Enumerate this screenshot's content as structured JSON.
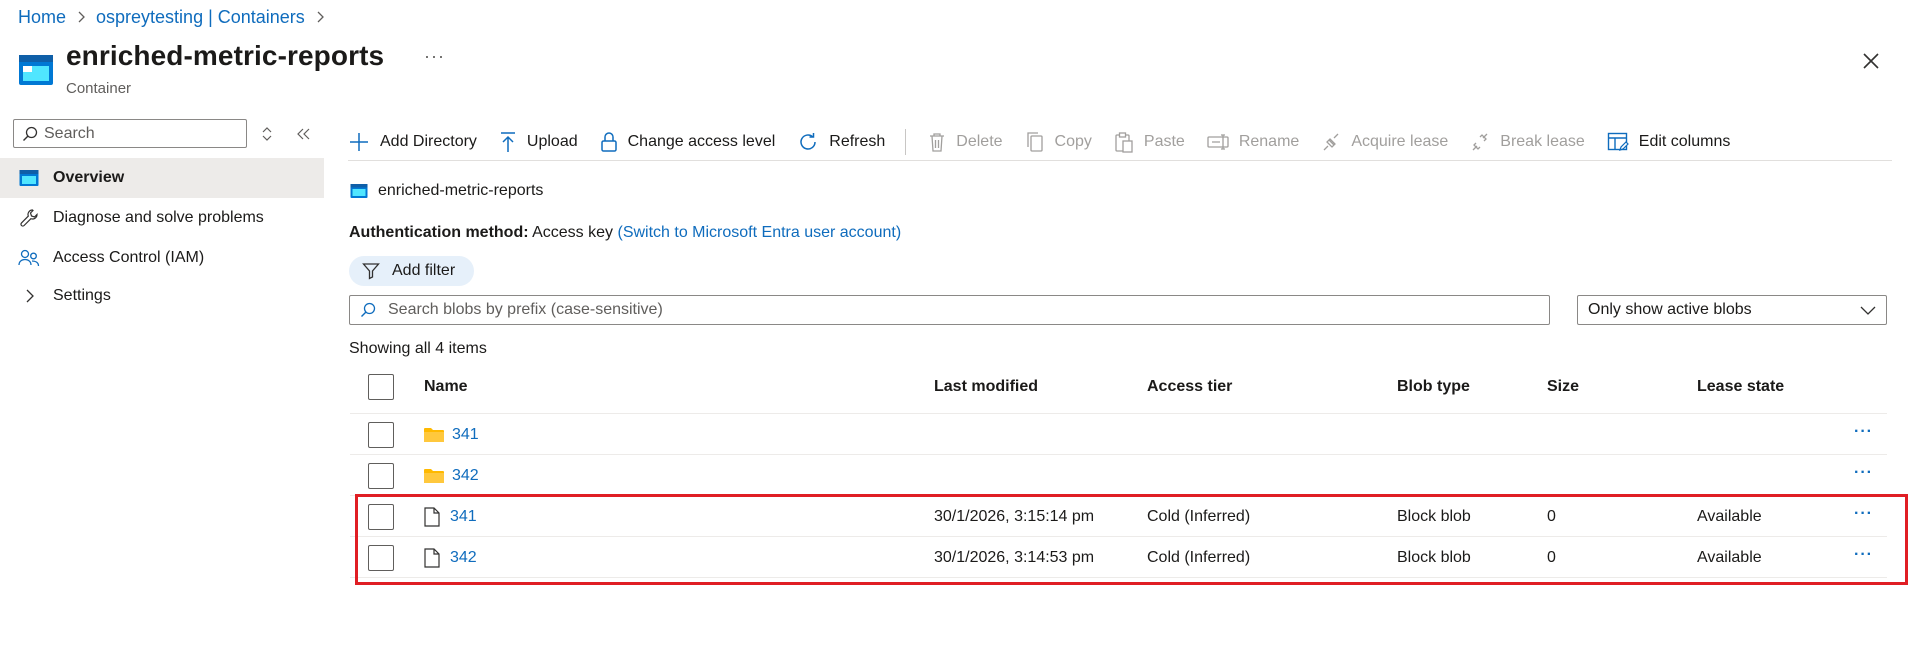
{
  "breadcrumb": {
    "home": "Home",
    "account": "ospreytesting | Containers"
  },
  "header": {
    "title": "enriched-metric-reports",
    "subtitle": "Container",
    "more": "···"
  },
  "sidebar": {
    "search_placeholder": "Search",
    "items": [
      {
        "label": "Overview",
        "icon": "container-icon",
        "active": true
      },
      {
        "label": "Diagnose and solve problems",
        "icon": "wrench-icon"
      },
      {
        "label": "Access Control (IAM)",
        "icon": "people-icon"
      },
      {
        "label": "Settings",
        "icon": "chevron-right-icon"
      }
    ]
  },
  "toolbar": {
    "add_directory": "Add Directory",
    "upload": "Upload",
    "change_access": "Change access level",
    "refresh": "Refresh",
    "delete": "Delete",
    "copy": "Copy",
    "paste": "Paste",
    "rename": "Rename",
    "acquire_lease": "Acquire lease",
    "break_lease": "Break lease",
    "edit_columns": "Edit columns"
  },
  "container_name": "enriched-metric-reports",
  "auth": {
    "label": "Authentication method:",
    "value": "Access key",
    "switch_link": "(Switch to Microsoft Entra user account)"
  },
  "filter": {
    "add_label": "Add filter"
  },
  "blob_search": {
    "placeholder": "Search blobs by prefix (case-sensitive)"
  },
  "state_dropdown": {
    "selected": "Only show active blobs"
  },
  "showing": "Showing all 4 items",
  "table": {
    "columns": {
      "name": "Name",
      "last_modified": "Last modified",
      "access_tier": "Access tier",
      "blob_type": "Blob type",
      "size": "Size",
      "lease_state": "Lease state"
    },
    "rows": [
      {
        "type": "folder",
        "name": "341",
        "last_modified": "",
        "access_tier": "",
        "blob_type": "",
        "size": "",
        "lease_state": ""
      },
      {
        "type": "folder",
        "name": "342",
        "last_modified": "",
        "access_tier": "",
        "blob_type": "",
        "size": "",
        "lease_state": ""
      },
      {
        "type": "file",
        "name": "341",
        "last_modified": "30/1/2026, 3:15:14 pm",
        "access_tier": "Cold (Inferred)",
        "blob_type": "Block blob",
        "size": "0",
        "lease_state": "Available"
      },
      {
        "type": "file",
        "name": "342",
        "last_modified": "30/1/2026, 3:14:53 pm",
        "access_tier": "Cold (Inferred)",
        "blob_type": "Block blob",
        "size": "0",
        "lease_state": "Available"
      }
    ],
    "row_more": "···"
  },
  "colors": {
    "link": "#0f6cbd",
    "highlight": "#e01e24",
    "folder": "#ffb900"
  }
}
